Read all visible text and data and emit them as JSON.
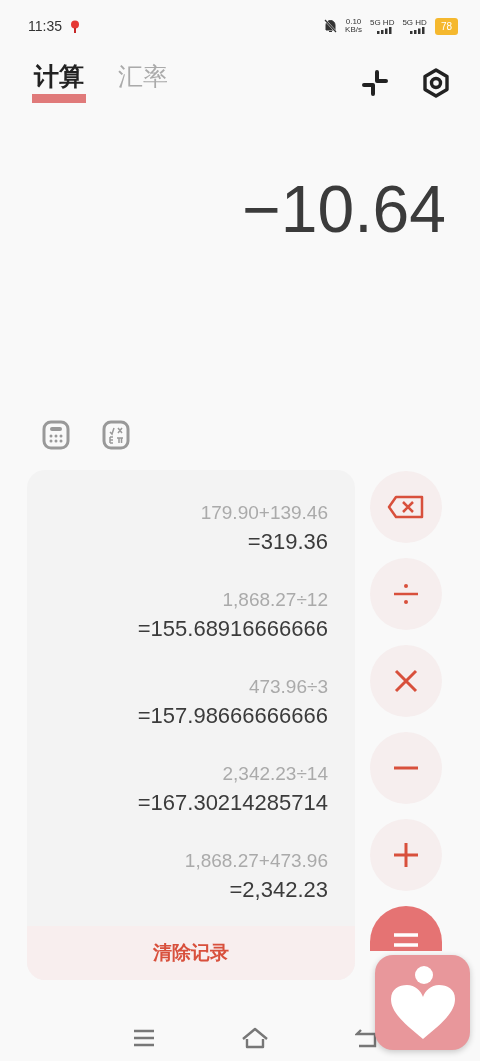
{
  "status_bar": {
    "time": "11:35",
    "net_speed": "0.10",
    "net_unit": "KB/s",
    "sim_labels": [
      "5G HD",
      "5G HD"
    ],
    "battery": "78"
  },
  "tabs": [
    {
      "label": "计算",
      "selected": true
    },
    {
      "label": "汇率",
      "selected": false
    }
  ],
  "display": {
    "value": "−10.64"
  },
  "modes": [
    {
      "kind": "basic"
    },
    {
      "kind": "scientific"
    }
  ],
  "history": [
    {
      "expression": "179.90+139.46",
      "result": "=319.36"
    },
    {
      "expression": "1,868.27÷12",
      "result": "=155.68916666666"
    },
    {
      "expression": "473.96÷3",
      "result": "=157.98666666666"
    },
    {
      "expression": "2,342.23÷14",
      "result": "=167.30214285714"
    },
    {
      "expression": "1,868.27+473.96",
      "result": "=2,342.23"
    }
  ],
  "clear_history": "清除记录",
  "keys": [
    {
      "kind": "backspace"
    },
    {
      "kind": "divide"
    },
    {
      "kind": "multiply"
    },
    {
      "kind": "minus"
    },
    {
      "kind": "plus"
    },
    {
      "kind": "equals"
    }
  ]
}
